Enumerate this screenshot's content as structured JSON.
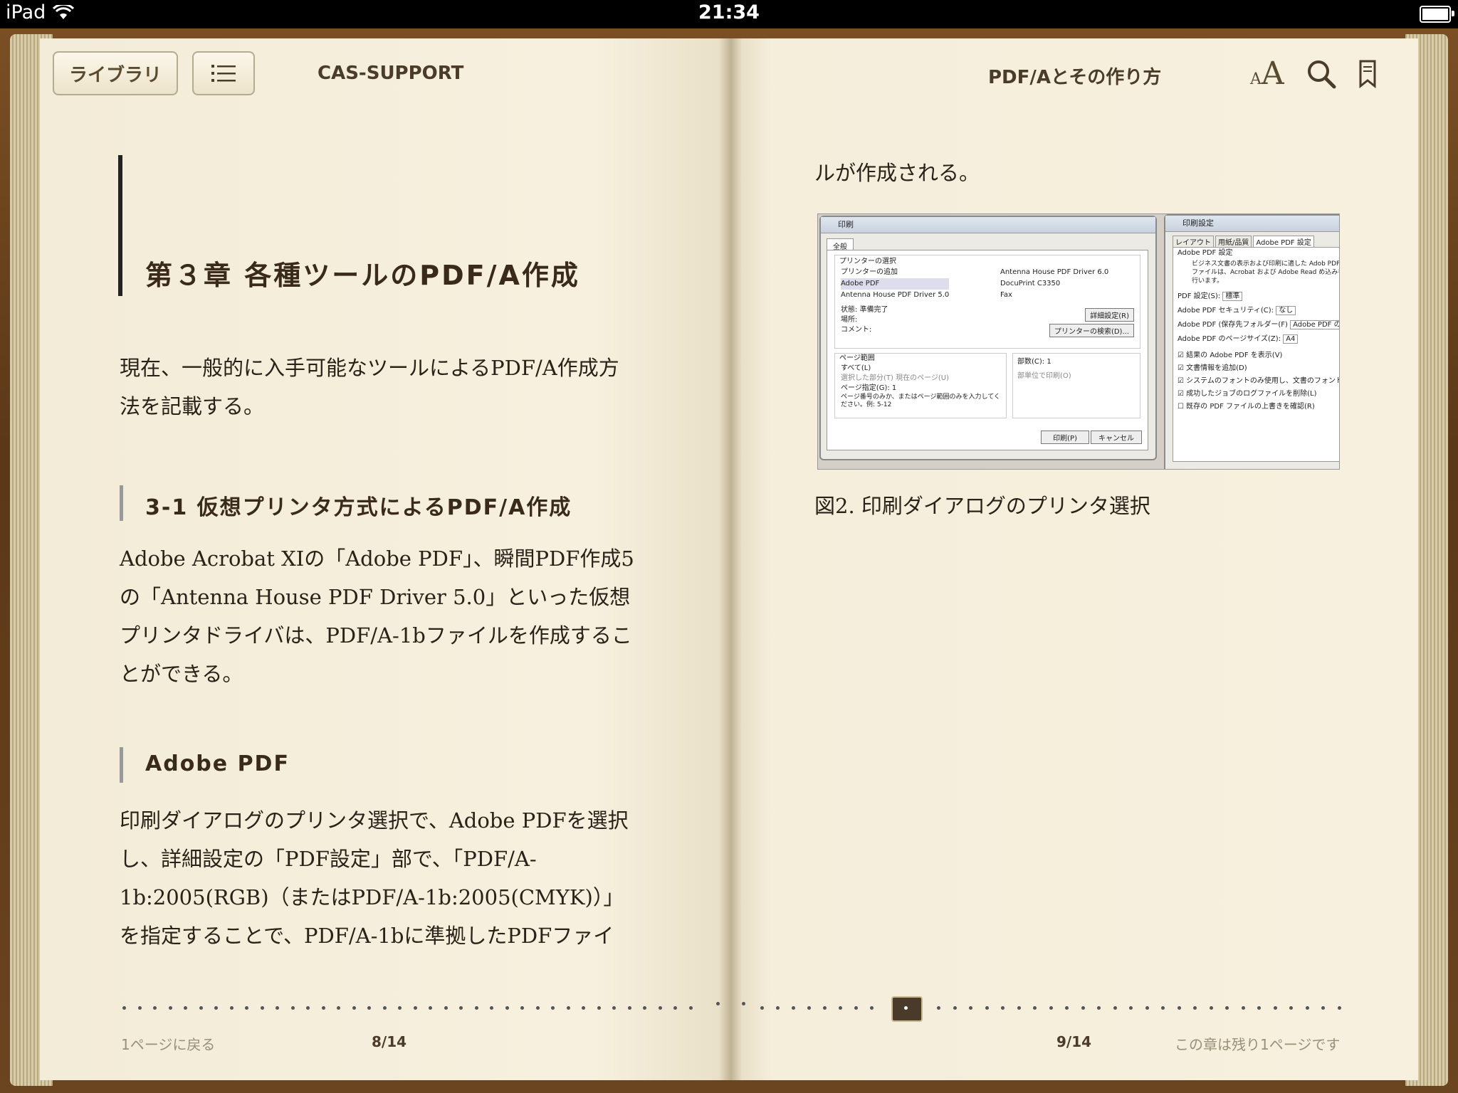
{
  "status_bar": {
    "device": "iPad",
    "time": "21:34"
  },
  "toolbar": {
    "library_label": "ライブラリ",
    "left_title": "CAS-SUPPORT",
    "right_title": "PDF/Aとその作り方",
    "font_size_label": "AA"
  },
  "left_page": {
    "chapter_title": "第３章 各種ツールのPDF/A作成",
    "intro": "現在、一般的に入手可能なツールによるPDF/A作成方法を記載する。",
    "section1_title": "3-1 仮想プリンタ方式によるPDF/A作成",
    "section1_body": "Adobe Acrobat XIの「Adobe PDF」、瞬間PDF作成5の「Antenna House PDF Driver 5.0」といった仮想プリンタドライバは、PDF/A-1bファイルを作成することができる。",
    "section2_title": "Adobe PDF",
    "section2_body": "印刷ダイアログのプリンタ選択で、Adobe PDFを選択し、詳細設定の「PDF設定」部で、「PDF/A-1b:2005(RGB)（またはPDF/A-1b:2005(CMYK)）」を指定することで、PDF/A-1bに準拠したPDFファイ",
    "footer_back": "1ページに戻る",
    "page_number": "8/14"
  },
  "right_page": {
    "continued_text": "ルが作成される。",
    "figure_caption": "図2. 印刷ダイアログのプリンタ選択",
    "page_number": "9/14",
    "footer_remaining": "この章は残り1ページです"
  },
  "figure": {
    "print_dialog": {
      "title": "印刷",
      "tab": "全般",
      "group_printer": "プリンターの選択",
      "printers": [
        "プリンターの追加",
        "Adobe PDF",
        "Antenna House PDF Driver 5.0",
        "Antenna House PDF Driver 6.0",
        "DocuPrint C3350",
        "Fax"
      ],
      "status_label": "状態:",
      "status_value": "準備完了",
      "location_label": "場所:",
      "comment_label": "コメント:",
      "detail_button": "詳細設定(R)",
      "find_button": "プリンターの検索(D)...",
      "group_range": "ページ範囲",
      "range_all": "すべて(L)",
      "range_selection": "選択した部分(T)",
      "range_current": "現在のページ(U)",
      "range_pages": "ページ指定(G):",
      "range_pages_value": "1",
      "range_hint": "ページ番号のみか、またはページ範囲のみを入力してください。例: 5-12",
      "copies_label": "部数(C):",
      "copies_value": "1",
      "collate_label": "部単位で印刷(O)",
      "print_button": "印刷(P)",
      "cancel_button": "キャンセル"
    },
    "settings_dialog": {
      "title": "印刷設定",
      "tabs": [
        "レイアウト",
        "用紙/品質",
        "Adobe PDF 設定"
      ],
      "group": "Adobe PDF 設定",
      "desc": "ビジネス文書の表示および印刷に適した Adob PDF ファイルは、Acrobat および Adobe Read め込みを行います。",
      "rows": [
        {
          "label": "PDF 設定(S):",
          "value": "標準"
        },
        {
          "label": "Adobe PDF セキュリティ(C):",
          "value": "なし"
        },
        {
          "label": "Adobe PDF (保存先フォルダー(F)",
          "value": "Adobe PDF の"
        },
        {
          "label": "Adobe PDF のページサイズ(Z):",
          "value": "A4"
        }
      ],
      "checks": [
        {
          "label": "結果の Adobe PDF を表示(V)",
          "checked": true
        },
        {
          "label": "文書情報を追加(D)",
          "checked": true
        },
        {
          "label": "システムのフォントのみ使用し、文書のフォント(",
          "checked": true
        },
        {
          "label": "成功したジョブのログファイルを削除(L)",
          "checked": true
        },
        {
          "label": "既存の PDF ファイルの上書きを確認(R)",
          "checked": false
        }
      ]
    }
  },
  "scrubber": {
    "current_page": 9,
    "total_pages": 14
  }
}
